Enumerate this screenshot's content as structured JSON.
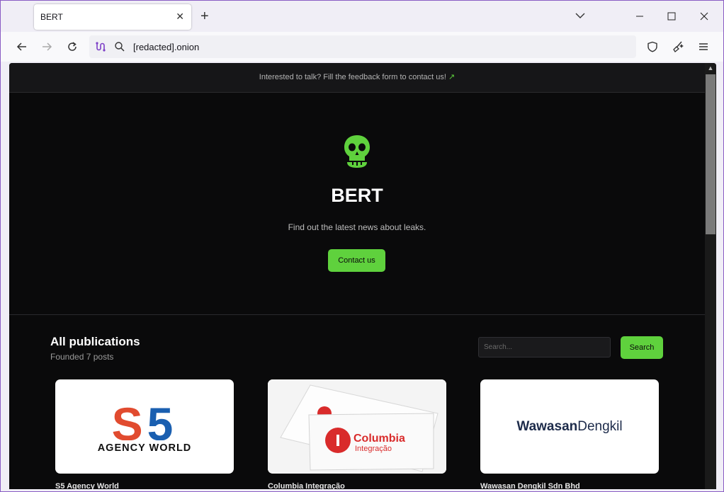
{
  "browser": {
    "tab_title": "BERT",
    "url": "[redacted].onion"
  },
  "page": {
    "banner_text": "Interested to talk? Fill the feedback form to contact us!",
    "banner_arrow": "↗",
    "hero_title": "BERT",
    "hero_subtitle": "Find out the latest news about leaks.",
    "contact_button": "Contact us",
    "publications_title": "All publications",
    "publications_count": "Founded 7 posts",
    "search_placeholder": "Search...",
    "search_button": "Search"
  },
  "cards": [
    {
      "logo_top": "S5",
      "logo_bottom": "AGENCY WORLD",
      "caption": "S5 Agency World"
    },
    {
      "logo_main": "Columbia",
      "logo_sub": "Integração",
      "caption": "Columbia Integração"
    },
    {
      "logo_a": "Wawasan",
      "logo_b": "Dengkil",
      "caption": "Wawasan Dengkil Sdn Bhd"
    }
  ],
  "colors": {
    "accent": "#5fd13d",
    "page_bg": "#0a0a0b",
    "browser_border": "#8a5cc4"
  },
  "icons": [
    "back-arrow-icon",
    "forward-arrow-icon",
    "reload-icon",
    "tor-circuit-icon",
    "search-icon",
    "shield-icon",
    "new-identity-icon",
    "menu-icon",
    "skull-icon",
    "external-arrow-icon"
  ]
}
